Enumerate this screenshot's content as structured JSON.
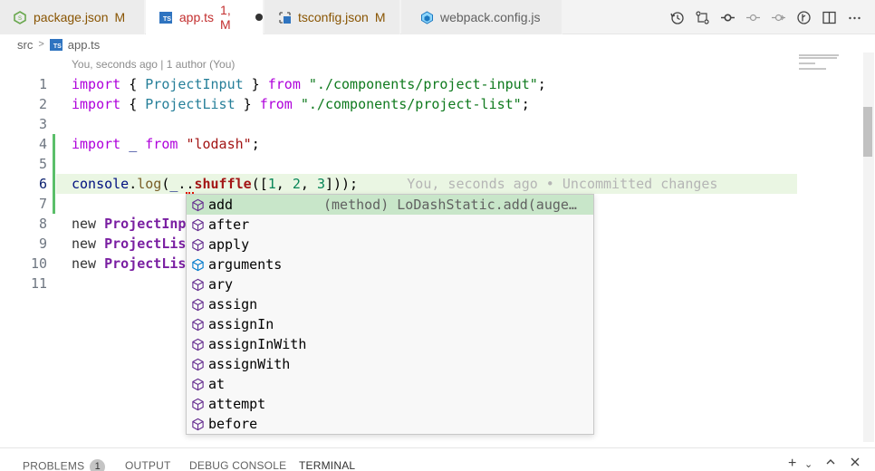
{
  "tabs": [
    {
      "label": "package.json",
      "status": "M",
      "icon": "nodejs-icon"
    },
    {
      "label": "app.ts",
      "status": "1, M",
      "icon": "typescript-icon",
      "dirty": true
    },
    {
      "label": "tsconfig.json",
      "status": "M",
      "icon": "typescript-config-icon"
    },
    {
      "label": "webpack.config.js",
      "status": "",
      "icon": "webpack-icon"
    }
  ],
  "tab_badge_text": "TS",
  "actions": [
    "history-icon",
    "compare-changes-icon",
    "git-commit-icon",
    "previous-change-icon",
    "next-change-icon",
    "gitlens-icon",
    "split-editor-icon",
    "more-actions-icon"
  ],
  "breadcrumb": {
    "folder": "src",
    "file": "app.ts"
  },
  "blame_header": "You, seconds ago | 1 author (You)",
  "lines": [
    {
      "n": "1"
    },
    {
      "n": "2"
    },
    {
      "n": "3"
    },
    {
      "n": "4"
    },
    {
      "n": "5"
    },
    {
      "n": "6"
    },
    {
      "n": "7"
    },
    {
      "n": "8"
    },
    {
      "n": "9"
    },
    {
      "n": "10"
    },
    {
      "n": "11"
    }
  ],
  "code": {
    "l1": {
      "kw1": "import",
      "p1": " { ",
      "cls": "ProjectInput",
      "p2": " } ",
      "kw2": "from",
      "p3": " ",
      "str": "\"./components/project-input\"",
      "p4": ";"
    },
    "l2": {
      "kw1": "import",
      "p1": " { ",
      "cls": "ProjectList",
      "p2": " } ",
      "kw2": "from",
      "p3": " ",
      "str": "\"./components/project-list\"",
      "p4": ";"
    },
    "l4": {
      "kw1": "import",
      "p1": " _ ",
      "kw2": "from",
      "p3": " ",
      "str": "\"lodash\"",
      "p4": ";"
    },
    "l6": {
      "obj": "console",
      "dot": ".",
      "fn": "log",
      "open": "(",
      "us": "_",
      "dot2": ".",
      "cursor": ".",
      "fn2": "shuffle",
      "args_open": "([",
      "n1": "1",
      "c1": ", ",
      "n2": "2",
      "c2": ", ",
      "n3": "3",
      "args_close": "]));",
      "blame": "You, seconds ago • Uncommitted changes"
    },
    "l8": {
      "kw": "new ",
      "cls": "ProjectInp"
    },
    "l9": {
      "kw": "new ",
      "cls": "ProjectLis"
    },
    "l10": {
      "kw": "new ",
      "cls": "ProjectLis"
    }
  },
  "suggest": {
    "items": [
      {
        "label": "add",
        "detail": "(method) LoDashStatic.add(auge…",
        "icon": "method-icon",
        "selected": true
      },
      {
        "label": "after",
        "icon": "method-icon"
      },
      {
        "label": "apply",
        "icon": "method-icon"
      },
      {
        "label": "arguments",
        "icon": "field-icon"
      },
      {
        "label": "ary",
        "icon": "method-icon"
      },
      {
        "label": "assign",
        "icon": "method-icon"
      },
      {
        "label": "assignIn",
        "icon": "method-icon"
      },
      {
        "label": "assignInWith",
        "icon": "method-icon"
      },
      {
        "label": "assignWith",
        "icon": "method-icon"
      },
      {
        "label": "at",
        "icon": "method-icon"
      },
      {
        "label": "attempt",
        "icon": "method-icon"
      },
      {
        "label": "before",
        "icon": "method-icon"
      }
    ]
  },
  "panel": {
    "tabs": [
      "PROBLEMS",
      "OUTPUT",
      "DEBUG CONSOLE",
      "TERMINAL"
    ],
    "problems_count": "1",
    "actions": [
      "add-terminal-icon",
      "chevron-down-icon",
      "maximize-panel-icon",
      "close-panel-icon"
    ]
  },
  "colors": {
    "added_line": "#5bbf6a",
    "selected_suggestion": "#c8e6c9",
    "current_line": "#eaf6e3"
  }
}
